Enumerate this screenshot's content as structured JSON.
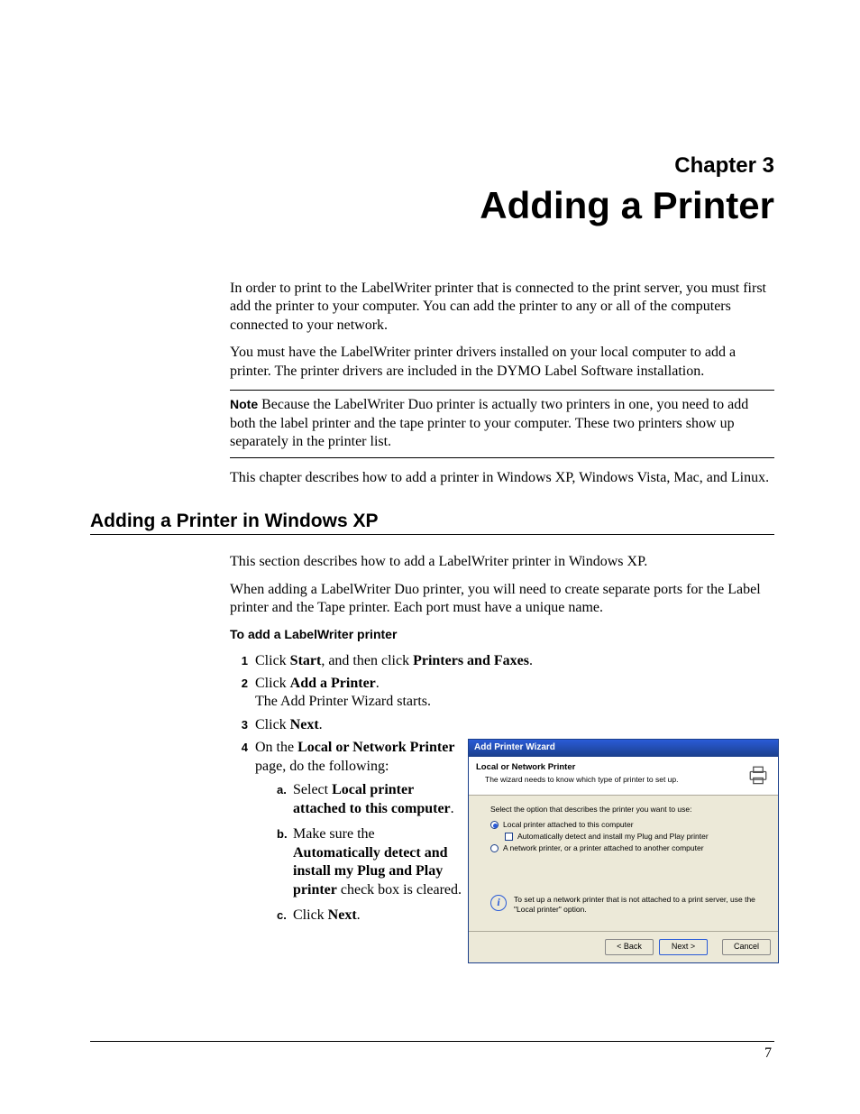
{
  "chapter": {
    "label": "Chapter 3",
    "title": "Adding a Printer"
  },
  "intro": {
    "p1": "In order to print to the LabelWriter printer that is connected to the print server, you must first add the printer to your computer. You can add the printer to any or all of the computers connected to your network.",
    "p2": "You must have the LabelWriter printer drivers installed on your local computer to add a printer. The printer drivers are included in the DYMO Label Software installation."
  },
  "note": {
    "label": "Note",
    "text": "  Because the LabelWriter Duo printer is actually two printers in one, you need to add both the label printer and the tape printer to your computer. These two printers show up separately in the printer list."
  },
  "after_note": "This chapter describes how to add a printer in Windows XP, Windows Vista, Mac, and Linux.",
  "section": {
    "heading": "Adding a Printer in Windows XP",
    "p1": "This section describes how to add a LabelWriter printer in Windows XP.",
    "p2": "When adding a LabelWriter Duo printer, you will need to create separate ports for the Label printer and the Tape printer. Each port must have a unique name.",
    "task_head": "To add a LabelWriter printer"
  },
  "steps": {
    "n1": "1",
    "s1_pre": "Click ",
    "s1_b1": "Start",
    "s1_mid": ", and then click ",
    "s1_b2": "Printers and Faxes",
    "s1_post": ".",
    "n2": "2",
    "s2_pre": "Click ",
    "s2_b1": "Add a Printer",
    "s2_post": ".",
    "s2_line2": "The Add Printer Wizard starts.",
    "n3": "3",
    "s3_pre": "Click ",
    "s3_b1": "Next",
    "s3_post": ".",
    "n4": "4",
    "s4_pre": "On the ",
    "s4_b1": "Local or Network Printer",
    "s4_post": " page, do the following:",
    "sa": "a.",
    "sa_pre": "Select ",
    "sa_b1": "Local printer attached to this computer",
    "sa_post": ".",
    "sb": "b.",
    "sb_pre": "Make sure the ",
    "sb_b1": "Automatically detect and install my Plug and Play printer",
    "sb_post": " check box is cleared.",
    "sc": "c.",
    "sc_pre": "Click ",
    "sc_b1": "Next",
    "sc_post": "."
  },
  "wizard": {
    "title": "Add Printer Wizard",
    "head_title": "Local or Network Printer",
    "head_sub": "The wizard needs to know which type of printer to set up.",
    "prompt": "Select the option that describes the printer you want to use:",
    "opt_local": "Local printer attached to this computer",
    "opt_auto": "Automatically detect and install my Plug and Play printer",
    "opt_network": "A network printer, or a printer attached to another computer",
    "info": "To set up a network printer that is not attached to a print server, use the \"Local printer\" option.",
    "back": "< Back",
    "next": "Next >",
    "cancel": "Cancel"
  },
  "page_number": "7"
}
